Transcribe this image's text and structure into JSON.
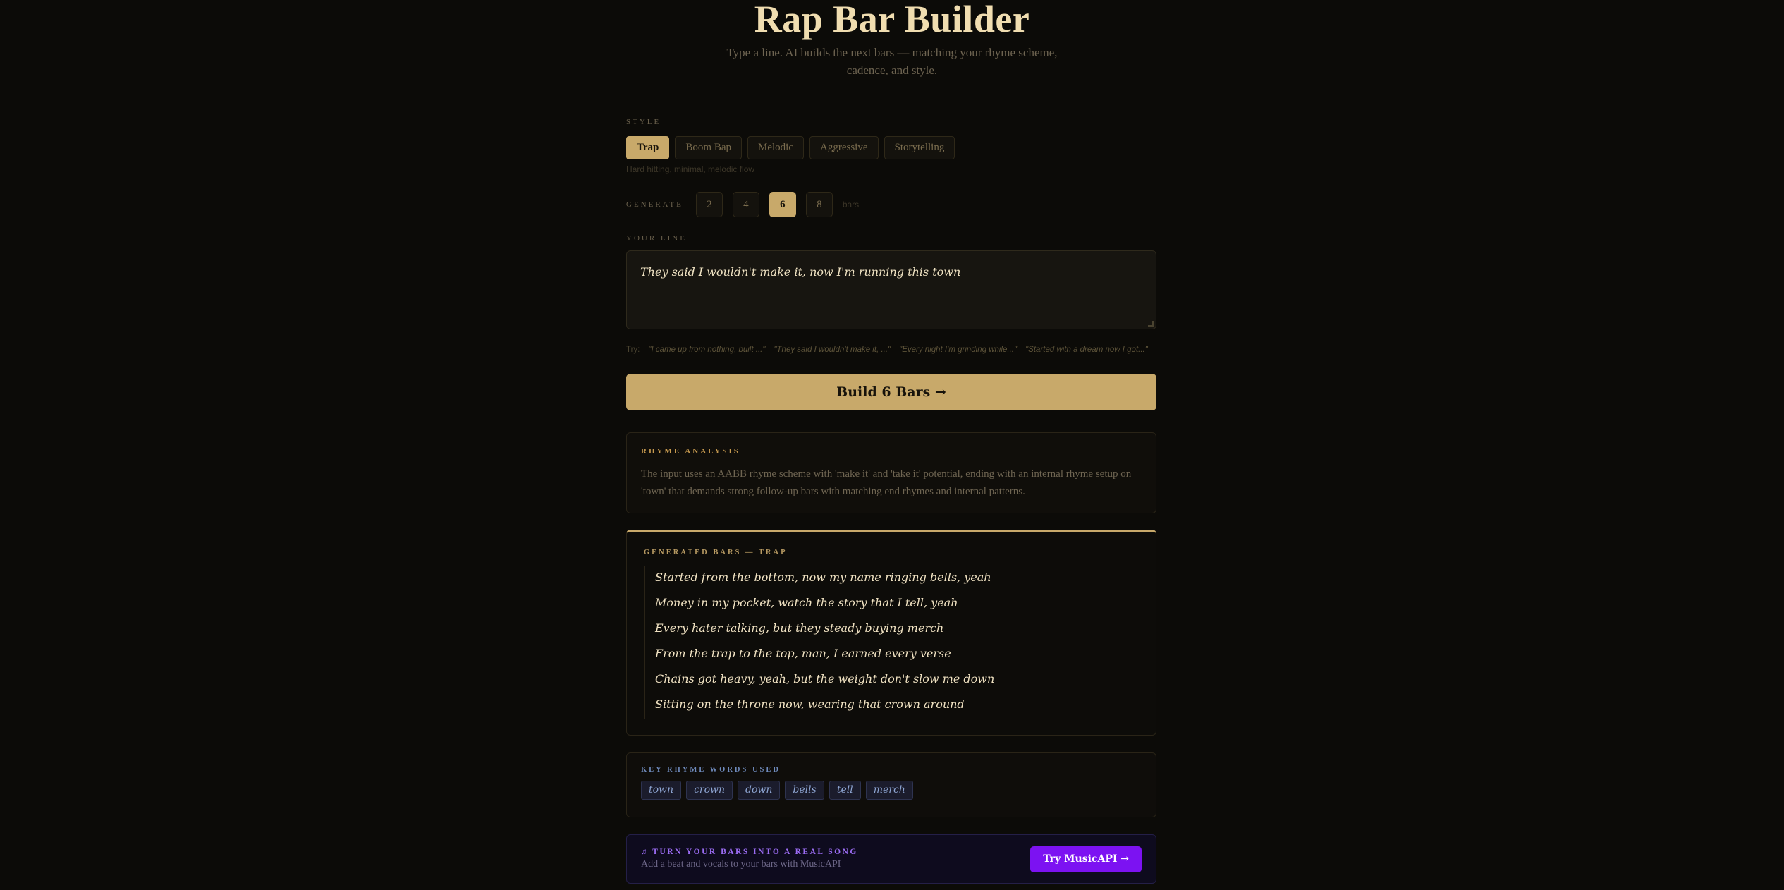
{
  "header": {
    "title": "Rap Bar Builder",
    "subtitle": "Type a line. AI builds the next bars — matching your rhyme scheme, cadence, and style."
  },
  "style_section": {
    "label": "Style",
    "options": [
      "Trap",
      "Boom Bap",
      "Melodic",
      "Aggressive",
      "Storytelling"
    ],
    "selected": "Trap",
    "description": "Hard hitting, minimal, melodic flow"
  },
  "generate_section": {
    "label": "Generate",
    "options": [
      "2",
      "4",
      "6",
      "8"
    ],
    "selected": "6",
    "suffix": "bars"
  },
  "line_section": {
    "label": "Your line",
    "value": "They said I wouldn't make it, now I'm running this town"
  },
  "try_row": {
    "label": "Try:",
    "examples": [
      "\"I came up from nothing, built ...\"",
      "\"They said I wouldn't make it, ...\"",
      "\"Every night I'm grinding while...\"",
      "\"Started with a dream now I got...\""
    ]
  },
  "build_button": {
    "label": "Build 6 Bars →"
  },
  "analysis": {
    "title": "Rhyme Analysis",
    "text": "The input uses an AABB rhyme scheme with 'make it' and 'take it' potential, ending with an internal rhyme setup on 'town' that demands strong follow-up bars with matching end rhymes and internal patterns."
  },
  "generated": {
    "title": "Generated Bars — Trap",
    "bars": [
      "Started from the bottom, now my name ringing bells, yeah",
      "Money in my pocket, watch the story that I tell, yeah",
      "Every hater talking, but they steady buying merch",
      "From the trap to the top, man, I earned every verse",
      "Chains got heavy, yeah, but the weight don't slow me down",
      "Sitting on the throne now, wearing that crown around"
    ]
  },
  "rhyme_words": {
    "title": "Key Rhyme Words Used",
    "words": [
      "town",
      "crown",
      "down",
      "bells",
      "tell",
      "merch"
    ]
  },
  "music_promo": {
    "icon": "music-note-icon",
    "title": "Turn your bars into a real song",
    "subtitle": "Add a beat and vocals to your bars with MusicAPI",
    "button_label": "Try MusicAPI →"
  },
  "colors": {
    "background": "#0c0b08",
    "accent": "#c8a96a",
    "rhyme_blue": "#6f8bbd",
    "music_purple": "#7c12f2"
  }
}
